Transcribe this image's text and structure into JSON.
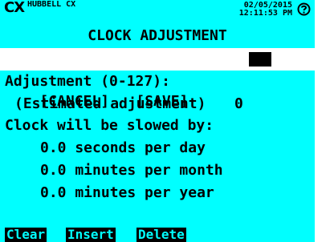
{
  "header": {
    "logo": "CX",
    "brand": "HUBBELL CX",
    "date": "02/05/2015",
    "time": "12:11:53 PM",
    "help_icon": "help-circle-icon"
  },
  "title": "CLOCK ADJUSTMENT",
  "adjustment": {
    "label": "Adjustment (0-127):",
    "value": "0"
  },
  "actions": {
    "cancel": "[CANCEL]",
    "save": "[SAVE]"
  },
  "estimate": {
    "heading": "(Estimated adjustment)",
    "intro": "Clock will be slowed by:",
    "per_day": "0.0 seconds per day",
    "per_month": "0.0 minutes per month",
    "per_year": "0.0 minutes per year"
  },
  "softkeys": {
    "clear": "Clear",
    "insert": "Insert",
    "delete": "Delete"
  },
  "colors": {
    "screen_bg": "#00ffff",
    "text": "#000000",
    "highlight_bg": "#ffffff"
  }
}
